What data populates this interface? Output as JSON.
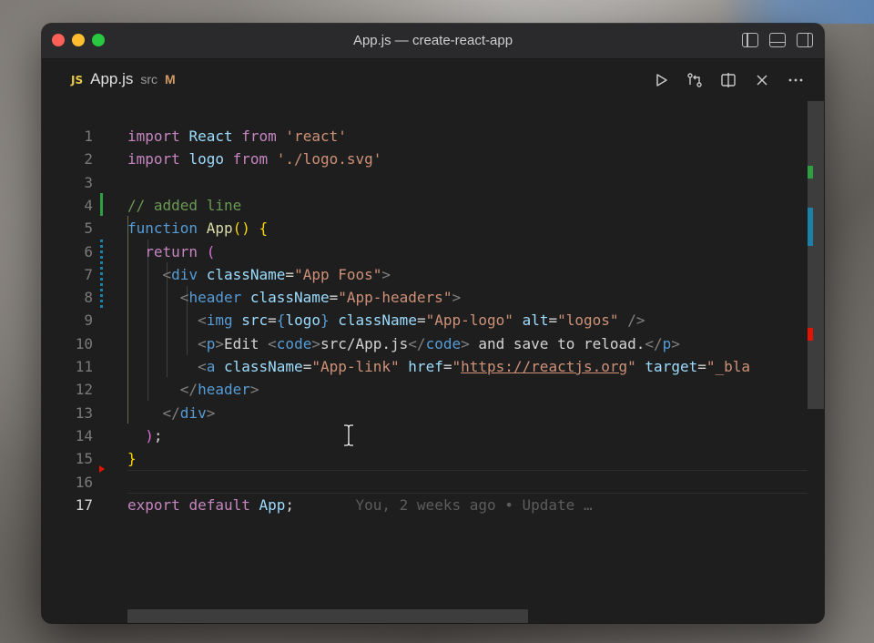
{
  "window": {
    "title": "App.js — create-react-app"
  },
  "tab": {
    "icon": "JS",
    "name": "App.js",
    "path": "src",
    "status": "M"
  },
  "toolbar": {
    "icons": [
      "run-icon",
      "compare-changes-icon",
      "split-editor-icon",
      "close-icon",
      "more-icon"
    ]
  },
  "layout_controls": [
    "toggle-primary-sidebar-icon",
    "toggle-panel-icon",
    "toggle-secondary-sidebar-icon"
  ],
  "editor": {
    "line_numbers": [
      "1",
      "2",
      "3",
      "4",
      "5",
      "6",
      "7",
      "8",
      "9",
      "10",
      "11",
      "12",
      "13",
      "14",
      "15",
      "16",
      "17"
    ],
    "active_line": "17",
    "blame": "You, 2 weeks ago • Update …",
    "lines": [
      [
        {
          "t": "import",
          "c": "kw"
        },
        {
          "t": " "
        },
        {
          "t": "React",
          "c": "id"
        },
        {
          "t": " "
        },
        {
          "t": "from",
          "c": "kw"
        },
        {
          "t": " "
        },
        {
          "t": "'react'",
          "c": "str"
        }
      ],
      [
        {
          "t": "import",
          "c": "kw"
        },
        {
          "t": " "
        },
        {
          "t": "logo",
          "c": "id"
        },
        {
          "t": " "
        },
        {
          "t": "from",
          "c": "kw"
        },
        {
          "t": " "
        },
        {
          "t": "'./logo.svg'",
          "c": "str"
        }
      ],
      [],
      [
        {
          "t": "// added line",
          "c": "cm"
        }
      ],
      [
        {
          "t": "function",
          "c": "kb"
        },
        {
          "t": " "
        },
        {
          "t": "App",
          "c": "fn"
        },
        {
          "t": "()",
          "c": "br"
        },
        {
          "t": " "
        },
        {
          "t": "{",
          "c": "br"
        }
      ],
      [
        {
          "t": "  "
        },
        {
          "t": "return",
          "c": "kw"
        },
        {
          "t": " "
        },
        {
          "t": "(",
          "c": "br2"
        }
      ],
      [
        {
          "t": "    "
        },
        {
          "t": "<",
          "c": "pn"
        },
        {
          "t": "div",
          "c": "tg"
        },
        {
          "t": " "
        },
        {
          "t": "className",
          "c": "id"
        },
        {
          "t": "=",
          "c": "txt"
        },
        {
          "t": "\"App Foos\"",
          "c": "str"
        },
        {
          "t": ">",
          "c": "pn"
        }
      ],
      [
        {
          "t": "      "
        },
        {
          "t": "<",
          "c": "pn"
        },
        {
          "t": "header",
          "c": "tg"
        },
        {
          "t": " "
        },
        {
          "t": "className",
          "c": "id"
        },
        {
          "t": "=",
          "c": "txt"
        },
        {
          "t": "\"App-headers\"",
          "c": "str"
        },
        {
          "t": ">",
          "c": "pn"
        }
      ],
      [
        {
          "t": "        "
        },
        {
          "t": "<",
          "c": "pn"
        },
        {
          "t": "img",
          "c": "tg"
        },
        {
          "t": " "
        },
        {
          "t": "src",
          "c": "id"
        },
        {
          "t": "=",
          "c": "txt"
        },
        {
          "t": "{",
          "c": "kb"
        },
        {
          "t": "logo",
          "c": "id"
        },
        {
          "t": "}",
          "c": "kb"
        },
        {
          "t": " "
        },
        {
          "t": "className",
          "c": "id"
        },
        {
          "t": "=",
          "c": "txt"
        },
        {
          "t": "\"App-logo\"",
          "c": "str"
        },
        {
          "t": " "
        },
        {
          "t": "alt",
          "c": "id"
        },
        {
          "t": "=",
          "c": "txt"
        },
        {
          "t": "\"logos\"",
          "c": "str"
        },
        {
          "t": " "
        },
        {
          "t": "/>",
          "c": "pn"
        }
      ],
      [
        {
          "t": "        "
        },
        {
          "t": "<",
          "c": "pn"
        },
        {
          "t": "p",
          "c": "tg"
        },
        {
          "t": ">",
          "c": "pn"
        },
        {
          "t": "Edit ",
          "c": "txt"
        },
        {
          "t": "<",
          "c": "pn"
        },
        {
          "t": "code",
          "c": "tg"
        },
        {
          "t": ">",
          "c": "pn"
        },
        {
          "t": "src/App.js",
          "c": "txt"
        },
        {
          "t": "</",
          "c": "pn"
        },
        {
          "t": "code",
          "c": "tg"
        },
        {
          "t": ">",
          "c": "pn"
        },
        {
          "t": " and save to reload.",
          "c": "txt"
        },
        {
          "t": "</",
          "c": "pn"
        },
        {
          "t": "p",
          "c": "tg"
        },
        {
          "t": ">",
          "c": "pn"
        }
      ],
      [
        {
          "t": "        "
        },
        {
          "t": "<",
          "c": "pn"
        },
        {
          "t": "a",
          "c": "tg"
        },
        {
          "t": " "
        },
        {
          "t": "className",
          "c": "id"
        },
        {
          "t": "=",
          "c": "txt"
        },
        {
          "t": "\"App-link\"",
          "c": "str"
        },
        {
          "t": " "
        },
        {
          "t": "href",
          "c": "id"
        },
        {
          "t": "=",
          "c": "txt"
        },
        {
          "t": "\"",
          "c": "str"
        },
        {
          "t": "https://reactjs.org",
          "c": "url"
        },
        {
          "t": "\"",
          "c": "str"
        },
        {
          "t": " "
        },
        {
          "t": "target",
          "c": "id"
        },
        {
          "t": "=",
          "c": "txt"
        },
        {
          "t": "\"_bla",
          "c": "str"
        }
      ],
      [
        {
          "t": "      "
        },
        {
          "t": "</",
          "c": "pn"
        },
        {
          "t": "header",
          "c": "tg"
        },
        {
          "t": ">",
          "c": "pn"
        }
      ],
      [
        {
          "t": "    "
        },
        {
          "t": "</",
          "c": "pn"
        },
        {
          "t": "div",
          "c": "tg"
        },
        {
          "t": ">",
          "c": "pn"
        }
      ],
      [
        {
          "t": "  "
        },
        {
          "t": ")",
          "c": "br2"
        },
        {
          "t": ";",
          "c": "txt"
        }
      ],
      [
        {
          "t": "}",
          "c": "br"
        }
      ],
      [],
      [
        {
          "t": "export",
          "c": "kw"
        },
        {
          "t": " "
        },
        {
          "t": "default",
          "c": "kw"
        },
        {
          "t": " "
        },
        {
          "t": "App",
          "c": "id"
        },
        {
          "t": ";",
          "c": "txt"
        }
      ]
    ]
  },
  "colors": {
    "editor_bg": "#1e1e1e",
    "titlebar_bg": "#2a2a2c",
    "git_added": "#2ea043",
    "git_modified": "#1b81a8",
    "git_deleted": "#e51400"
  }
}
